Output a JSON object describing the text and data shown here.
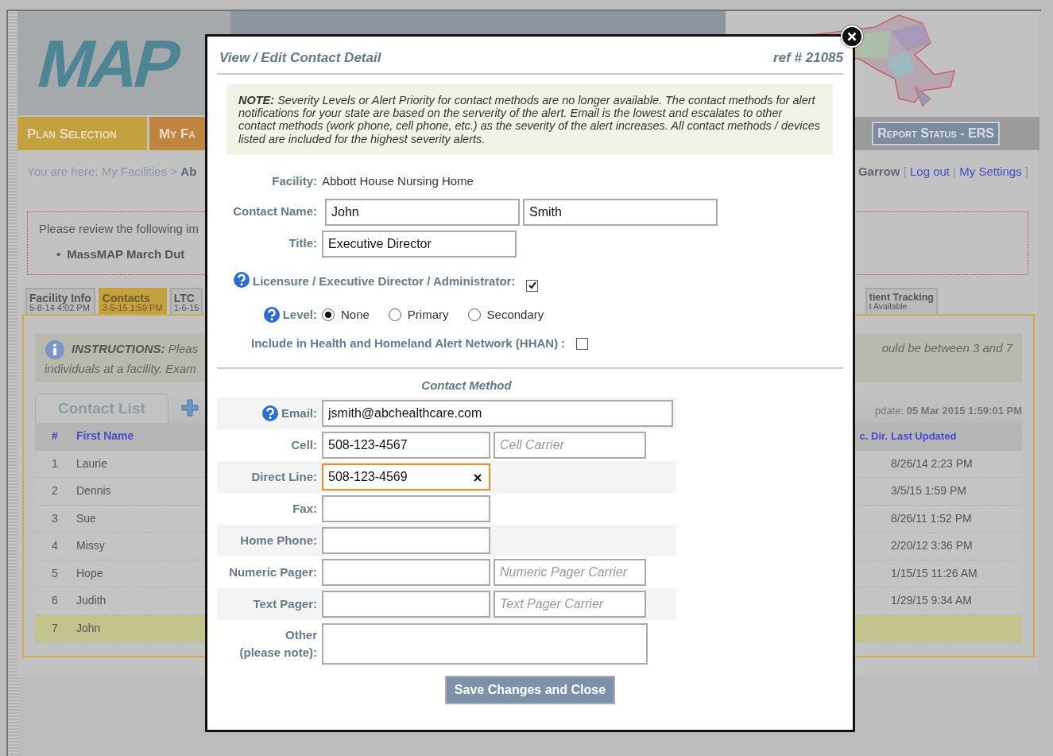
{
  "header": {
    "logo": "MAP",
    "nav": [
      {
        "label": "Plan Selection",
        "kind": "plan"
      },
      {
        "label": "My Fa",
        "kind": "facilities"
      }
    ],
    "report_button": "Report Status - ERS"
  },
  "breadcrumb": {
    "prefix": "You are here:",
    "link": "My Facilities",
    "separator": ">",
    "current": "Ab"
  },
  "user_links": {
    "name": "Garrow",
    "open": "[",
    "links": [
      "Log out",
      "My Settings"
    ],
    "separator": "|",
    "close": "]"
  },
  "alert": {
    "text": "Please review the following im",
    "bullet_marker": "•",
    "bullet": "MassMAP March Dut"
  },
  "tabs": [
    {
      "label": "Facility Info",
      "date": "5-8-14 4:02 PM",
      "selected": false
    },
    {
      "label": "Contacts",
      "date": "3-5-15 1:59 PM",
      "selected": true
    },
    {
      "label": "LTC",
      "date": "1-6-15",
      "selected": false
    }
  ],
  "right_tab": {
    "label": "tient Tracking",
    "date": "t Available"
  },
  "instructions": {
    "heading": "INSTRUCTIONS:",
    "line_1": "Pleas",
    "line_2": "individuals at a facility. Exam",
    "right": "ould be between 3 and 7"
  },
  "contact_list": {
    "tab": "Contact List",
    "update_label": "pdate:",
    "update_value": "05 Mar 2015 1:59:01 PM",
    "columns_left": [
      "#",
      "First Name"
    ],
    "columns_right": [
      "c. Dir.",
      "Last Updated"
    ],
    "rows": [
      {
        "number": "1",
        "first_name": "Laurie",
        "last_updated": "8/26/14 2:23 PM",
        "selected": false
      },
      {
        "number": "2",
        "first_name": "Dennis",
        "last_updated": "3/5/15 1:59 PM",
        "selected": false
      },
      {
        "number": "3",
        "first_name": "Sue",
        "last_updated": "8/26/11 1:52 PM",
        "selected": false
      },
      {
        "number": "4",
        "first_name": "Missy",
        "last_updated": "2/20/12 3:36 PM",
        "selected": false
      },
      {
        "number": "5",
        "first_name": "Hope",
        "last_updated": "1/15/15 11:26 AM",
        "selected": false
      },
      {
        "number": "6",
        "first_name": "Judith",
        "last_updated": "1/29/15 9:34 AM",
        "selected": false
      },
      {
        "number": "7",
        "first_name": "John",
        "selected": true
      }
    ]
  },
  "modal": {
    "title": "View / Edit Contact Detail",
    "ref": "ref # 21085",
    "note": {
      "label": "NOTE:",
      "text": "Severity Levels or Alert Priority for contact methods are no longer available. The contact methods for alert notifications for your state are based on the serverity of the alert. Email is the lowest and escalates to other contact methods (work phone, cell phone, etc.) as the severity of the alert increases. All contact methods / devices listed are included for the highest severity alerts."
    },
    "facility": {
      "label": "Facility:",
      "value": "Abbott House Nursing Home"
    },
    "contact_name": {
      "label": "Contact Name:",
      "first": "John",
      "last": "Smith"
    },
    "title_field": {
      "label": "Title:",
      "value": "Executive Director"
    },
    "licensure": {
      "label": "Licensure / Executive Director / Administrator:",
      "checked": true
    },
    "level": {
      "label": "Level:",
      "options": [
        {
          "label": "None",
          "selected": true
        },
        {
          "label": "Primary",
          "selected": false
        },
        {
          "label": "Secondary",
          "selected": false
        }
      ]
    },
    "hhan": {
      "label": "Include in Health and Homeland Alert Network (HHAN) :",
      "checked": false
    },
    "contact_method": {
      "heading": "Contact Method",
      "rows": [
        {
          "label": [
            "Email:"
          ],
          "kind": "wide",
          "value": "jsmith@abchealthcare.com",
          "help": true,
          "focused": false
        },
        {
          "label": [
            "Cell:"
          ],
          "kind": "carrier",
          "value": "508-123-4567",
          "carrier_placeholder": "Cell Carrier",
          "focused": false
        },
        {
          "label": [
            "Direct Line:"
          ],
          "kind": "plain",
          "value": "508-123-4569",
          "focused": true
        },
        {
          "label": [
            "Fax:"
          ],
          "kind": "plain",
          "focused": false
        },
        {
          "label": [
            "Home Phone:"
          ],
          "kind": "plain",
          "focused": false
        },
        {
          "label": [
            "Numeric Pager:"
          ],
          "kind": "carrier",
          "carrier_placeholder": "Numeric Pager Carrier",
          "focused": false
        },
        {
          "label": [
            "Text Pager:"
          ],
          "kind": "carrier",
          "carrier_placeholder": "Text Pager Carrier",
          "focused": false
        },
        {
          "label": [
            "Other",
            "(please note):"
          ],
          "kind": "textarea",
          "focused": false
        }
      ]
    },
    "save_button": "Save Changes and Close"
  }
}
